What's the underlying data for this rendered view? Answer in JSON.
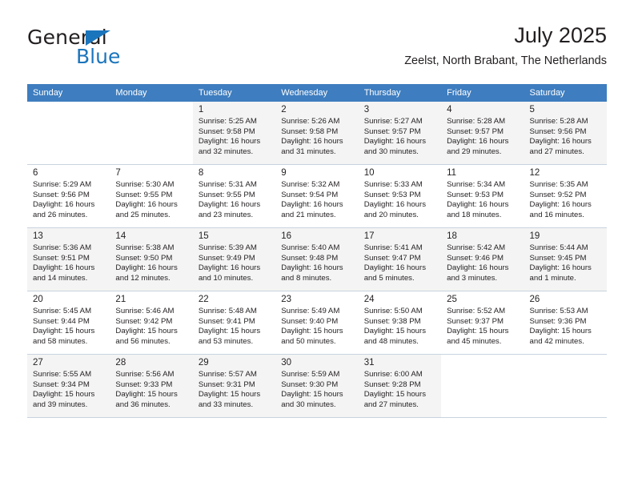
{
  "brand": {
    "name_top": "General",
    "name_bottom": "Blue",
    "accent_color": "#1b75bc"
  },
  "header": {
    "title": "July 2025",
    "subtitle": "Zeelst, North Brabant, The Netherlands"
  },
  "calendar": {
    "header_color": "#3e7dbf",
    "weekday_headers": [
      "Sunday",
      "Monday",
      "Tuesday",
      "Wednesday",
      "Thursday",
      "Friday",
      "Saturday"
    ],
    "weeks": [
      {
        "band": true,
        "days": [
          {
            "empty": true
          },
          {
            "empty": true
          },
          {
            "num": "1",
            "sunrise": "Sunrise: 5:25 AM",
            "sunset": "Sunset: 9:58 PM",
            "daylight": "Daylight: 16 hours and 32 minutes."
          },
          {
            "num": "2",
            "sunrise": "Sunrise: 5:26 AM",
            "sunset": "Sunset: 9:58 PM",
            "daylight": "Daylight: 16 hours and 31 minutes."
          },
          {
            "num": "3",
            "sunrise": "Sunrise: 5:27 AM",
            "sunset": "Sunset: 9:57 PM",
            "daylight": "Daylight: 16 hours and 30 minutes."
          },
          {
            "num": "4",
            "sunrise": "Sunrise: 5:28 AM",
            "sunset": "Sunset: 9:57 PM",
            "daylight": "Daylight: 16 hours and 29 minutes."
          },
          {
            "num": "5",
            "sunrise": "Sunrise: 5:28 AM",
            "sunset": "Sunset: 9:56 PM",
            "daylight": "Daylight: 16 hours and 27 minutes."
          }
        ]
      },
      {
        "band": false,
        "days": [
          {
            "num": "6",
            "sunrise": "Sunrise: 5:29 AM",
            "sunset": "Sunset: 9:56 PM",
            "daylight": "Daylight: 16 hours and 26 minutes."
          },
          {
            "num": "7",
            "sunrise": "Sunrise: 5:30 AM",
            "sunset": "Sunset: 9:55 PM",
            "daylight": "Daylight: 16 hours and 25 minutes."
          },
          {
            "num": "8",
            "sunrise": "Sunrise: 5:31 AM",
            "sunset": "Sunset: 9:55 PM",
            "daylight": "Daylight: 16 hours and 23 minutes."
          },
          {
            "num": "9",
            "sunrise": "Sunrise: 5:32 AM",
            "sunset": "Sunset: 9:54 PM",
            "daylight": "Daylight: 16 hours and 21 minutes."
          },
          {
            "num": "10",
            "sunrise": "Sunrise: 5:33 AM",
            "sunset": "Sunset: 9:53 PM",
            "daylight": "Daylight: 16 hours and 20 minutes."
          },
          {
            "num": "11",
            "sunrise": "Sunrise: 5:34 AM",
            "sunset": "Sunset: 9:53 PM",
            "daylight": "Daylight: 16 hours and 18 minutes."
          },
          {
            "num": "12",
            "sunrise": "Sunrise: 5:35 AM",
            "sunset": "Sunset: 9:52 PM",
            "daylight": "Daylight: 16 hours and 16 minutes."
          }
        ]
      },
      {
        "band": true,
        "days": [
          {
            "num": "13",
            "sunrise": "Sunrise: 5:36 AM",
            "sunset": "Sunset: 9:51 PM",
            "daylight": "Daylight: 16 hours and 14 minutes."
          },
          {
            "num": "14",
            "sunrise": "Sunrise: 5:38 AM",
            "sunset": "Sunset: 9:50 PM",
            "daylight": "Daylight: 16 hours and 12 minutes."
          },
          {
            "num": "15",
            "sunrise": "Sunrise: 5:39 AM",
            "sunset": "Sunset: 9:49 PM",
            "daylight": "Daylight: 16 hours and 10 minutes."
          },
          {
            "num": "16",
            "sunrise": "Sunrise: 5:40 AM",
            "sunset": "Sunset: 9:48 PM",
            "daylight": "Daylight: 16 hours and 8 minutes."
          },
          {
            "num": "17",
            "sunrise": "Sunrise: 5:41 AM",
            "sunset": "Sunset: 9:47 PM",
            "daylight": "Daylight: 16 hours and 5 minutes."
          },
          {
            "num": "18",
            "sunrise": "Sunrise: 5:42 AM",
            "sunset": "Sunset: 9:46 PM",
            "daylight": "Daylight: 16 hours and 3 minutes."
          },
          {
            "num": "19",
            "sunrise": "Sunrise: 5:44 AM",
            "sunset": "Sunset: 9:45 PM",
            "daylight": "Daylight: 16 hours and 1 minute."
          }
        ]
      },
      {
        "band": false,
        "days": [
          {
            "num": "20",
            "sunrise": "Sunrise: 5:45 AM",
            "sunset": "Sunset: 9:44 PM",
            "daylight": "Daylight: 15 hours and 58 minutes."
          },
          {
            "num": "21",
            "sunrise": "Sunrise: 5:46 AM",
            "sunset": "Sunset: 9:42 PM",
            "daylight": "Daylight: 15 hours and 56 minutes."
          },
          {
            "num": "22",
            "sunrise": "Sunrise: 5:48 AM",
            "sunset": "Sunset: 9:41 PM",
            "daylight": "Daylight: 15 hours and 53 minutes."
          },
          {
            "num": "23",
            "sunrise": "Sunrise: 5:49 AM",
            "sunset": "Sunset: 9:40 PM",
            "daylight": "Daylight: 15 hours and 50 minutes."
          },
          {
            "num": "24",
            "sunrise": "Sunrise: 5:50 AM",
            "sunset": "Sunset: 9:38 PM",
            "daylight": "Daylight: 15 hours and 48 minutes."
          },
          {
            "num": "25",
            "sunrise": "Sunrise: 5:52 AM",
            "sunset": "Sunset: 9:37 PM",
            "daylight": "Daylight: 15 hours and 45 minutes."
          },
          {
            "num": "26",
            "sunrise": "Sunrise: 5:53 AM",
            "sunset": "Sunset: 9:36 PM",
            "daylight": "Daylight: 15 hours and 42 minutes."
          }
        ]
      },
      {
        "band": true,
        "days": [
          {
            "num": "27",
            "sunrise": "Sunrise: 5:55 AM",
            "sunset": "Sunset: 9:34 PM",
            "daylight": "Daylight: 15 hours and 39 minutes."
          },
          {
            "num": "28",
            "sunrise": "Sunrise: 5:56 AM",
            "sunset": "Sunset: 9:33 PM",
            "daylight": "Daylight: 15 hours and 36 minutes."
          },
          {
            "num": "29",
            "sunrise": "Sunrise: 5:57 AM",
            "sunset": "Sunset: 9:31 PM",
            "daylight": "Daylight: 15 hours and 33 minutes."
          },
          {
            "num": "30",
            "sunrise": "Sunrise: 5:59 AM",
            "sunset": "Sunset: 9:30 PM",
            "daylight": "Daylight: 15 hours and 30 minutes."
          },
          {
            "num": "31",
            "sunrise": "Sunrise: 6:00 AM",
            "sunset": "Sunset: 9:28 PM",
            "daylight": "Daylight: 15 hours and 27 minutes."
          },
          {
            "empty": true
          },
          {
            "empty": true
          }
        ]
      }
    ]
  }
}
